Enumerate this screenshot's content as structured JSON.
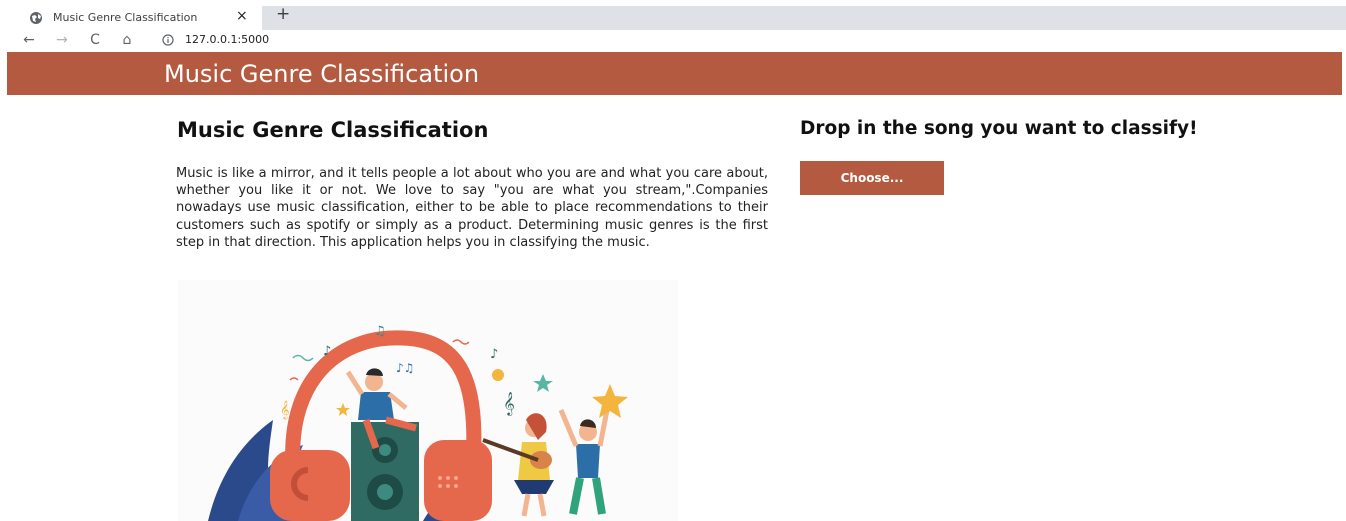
{
  "browser": {
    "tab_title": "Music Genre Classification",
    "tab_close": "×",
    "new_tab": "+",
    "url": "127.0.0.1:5000",
    "nav": {
      "back": "←",
      "forward": "→",
      "reload": "C",
      "home": "⌂"
    }
  },
  "header": {
    "brand": "Music Genre Classification"
  },
  "main": {
    "title": "Music Genre Classification",
    "description": "Music is like a mirror, and it tells people a lot about who you are and what you care about, whether you like it or not. We love to say \"you are what you stream,\".Companies nowadays use music classification, either to be able to place recommendations to their customers such as spotify or simply as a product. Determining music genres is the first step in that direction. This application helps you in classifying the music."
  },
  "upload": {
    "heading": "Drop in the song you want to classify!",
    "button_label": "Choose..."
  },
  "colors": {
    "accent": "#b35a40",
    "headphones": "#e5674c",
    "speaker": "#2f6a63",
    "foliage": "#2b4a8c"
  }
}
